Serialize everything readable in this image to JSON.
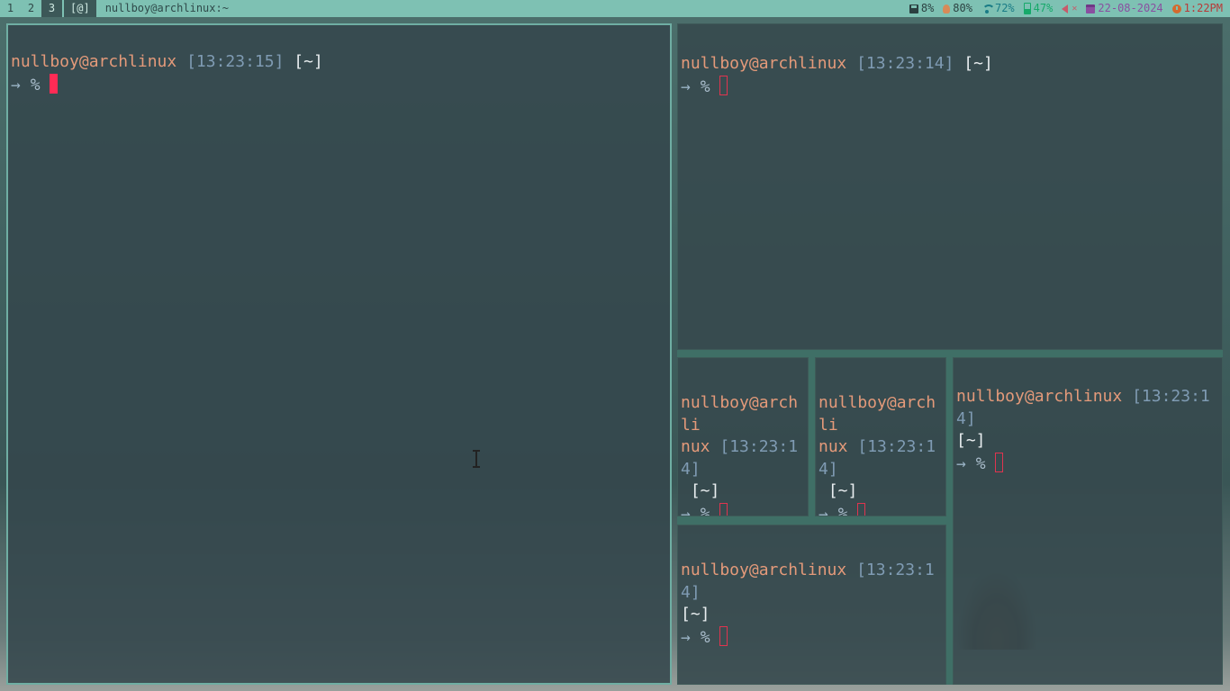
{
  "bar": {
    "tags": [
      "1",
      "2",
      "3"
    ],
    "active_tag": "3",
    "layout": "[@]",
    "window_title": "nullboy@archlinux:~",
    "status": {
      "disk": "8%",
      "brightness": "80%",
      "wifi": "72%",
      "battery": "47%",
      "date": "22-08-2024",
      "time": "1:22PM"
    },
    "colors": {
      "bar_bg": "#7ec1b3",
      "wifi": "#1a7c86",
      "battery": "#17a96a",
      "volume_muted": "#c85a6a",
      "date": "#8a4fa0",
      "time": "#b83a38"
    }
  },
  "terminals": [
    {
      "user": "nullboy@archlinux",
      "time": "[13:23:15]",
      "dir": "[~]",
      "arrow": "→",
      "prompt": "%",
      "focused": true
    },
    {
      "user": "nullboy@archlinux",
      "time": "[13:23:14]",
      "dir": "[~]",
      "arrow": "→",
      "prompt": "%",
      "focused": false
    },
    {
      "user_a": "nullboy@archli",
      "user_b": "nux",
      "time": "[13:23:14]",
      "dir": "[~]",
      "arrow": "→",
      "prompt": "%",
      "focused": false
    },
    {
      "user_a": "nullboy@archli",
      "user_b": "nux",
      "time": "[13:23:14]",
      "dir": "[~]",
      "arrow": "→",
      "prompt": "%",
      "focused": false
    },
    {
      "user": "nullboy@archlinux",
      "time": "[13:23:14]",
      "dir": "[~]",
      "arrow": "→",
      "prompt": "%",
      "focused": false
    },
    {
      "user": "nullboy@archlinux",
      "time": "[13:23:14]",
      "dir": "[~]",
      "arrow": "→",
      "prompt": "%",
      "focused": false
    }
  ]
}
